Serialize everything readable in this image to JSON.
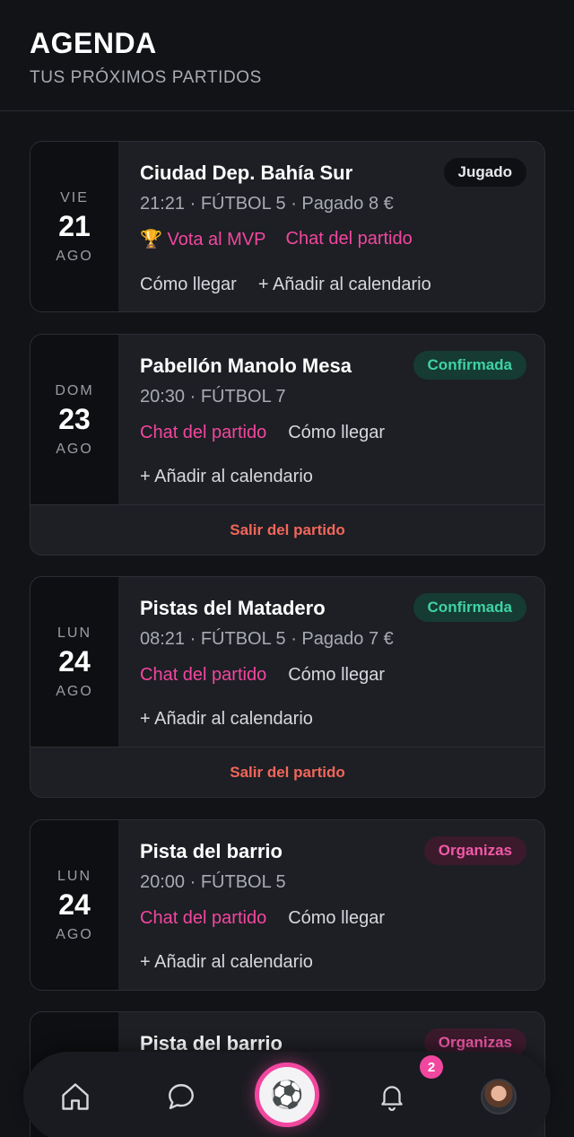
{
  "header": {
    "title": "AGENDA",
    "subtitle": "TUS PRÓXIMOS PARTIDOS"
  },
  "matches": [
    {
      "dow": "VIE",
      "day": "21",
      "month": "AGO",
      "venue": "Ciudad Dep. Bahía Sur",
      "status": "Jugado",
      "meta": "21:21 · FÚTBOL 5 · Pagado 8 €",
      "mvp": "🏆 Vota al MVP",
      "chat": "Chat del partido",
      "directions": "Cómo llegar",
      "calendar": "+ Añadir al calendario"
    },
    {
      "dow": "DOM",
      "day": "23",
      "month": "AGO",
      "venue": "Pabellón Manolo Mesa",
      "status": "Confirmada",
      "meta": "20:30 · FÚTBOL 7",
      "chat": "Chat del partido",
      "directions": "Cómo llegar",
      "calendar": "+ Añadir al calendario",
      "leave": "Salir del partido"
    },
    {
      "dow": "LUN",
      "day": "24",
      "month": "AGO",
      "venue": "Pistas del Matadero",
      "status": "Confirmada",
      "meta": "08:21 · FÚTBOL 5 · Pagado 7 €",
      "chat": "Chat del partido",
      "directions": "Cómo llegar",
      "calendar": "+ Añadir al calendario",
      "leave": "Salir del partido"
    },
    {
      "dow": "LUN",
      "day": "24",
      "month": "AGO",
      "venue": "Pista del barrio",
      "status": "Organizas",
      "meta": "20:00 · FÚTBOL 5",
      "chat": "Chat del partido",
      "directions": "Cómo llegar",
      "calendar": "+ Añadir al calendario"
    },
    {
      "venue": "Pista del barrio",
      "status": "Organizas"
    }
  ],
  "nav": {
    "items": [
      "home-icon",
      "chat-icon",
      "soccer-ball-icon",
      "bell-icon",
      "avatar"
    ],
    "center_icon": "⚽",
    "notifications_count": "2"
  },
  "colors": {
    "background": "#121317",
    "card": "#1d1f24",
    "accent_pink": "#f2479f",
    "confirmed_green": "#3fd2a4",
    "leave_red": "#f2665a"
  }
}
